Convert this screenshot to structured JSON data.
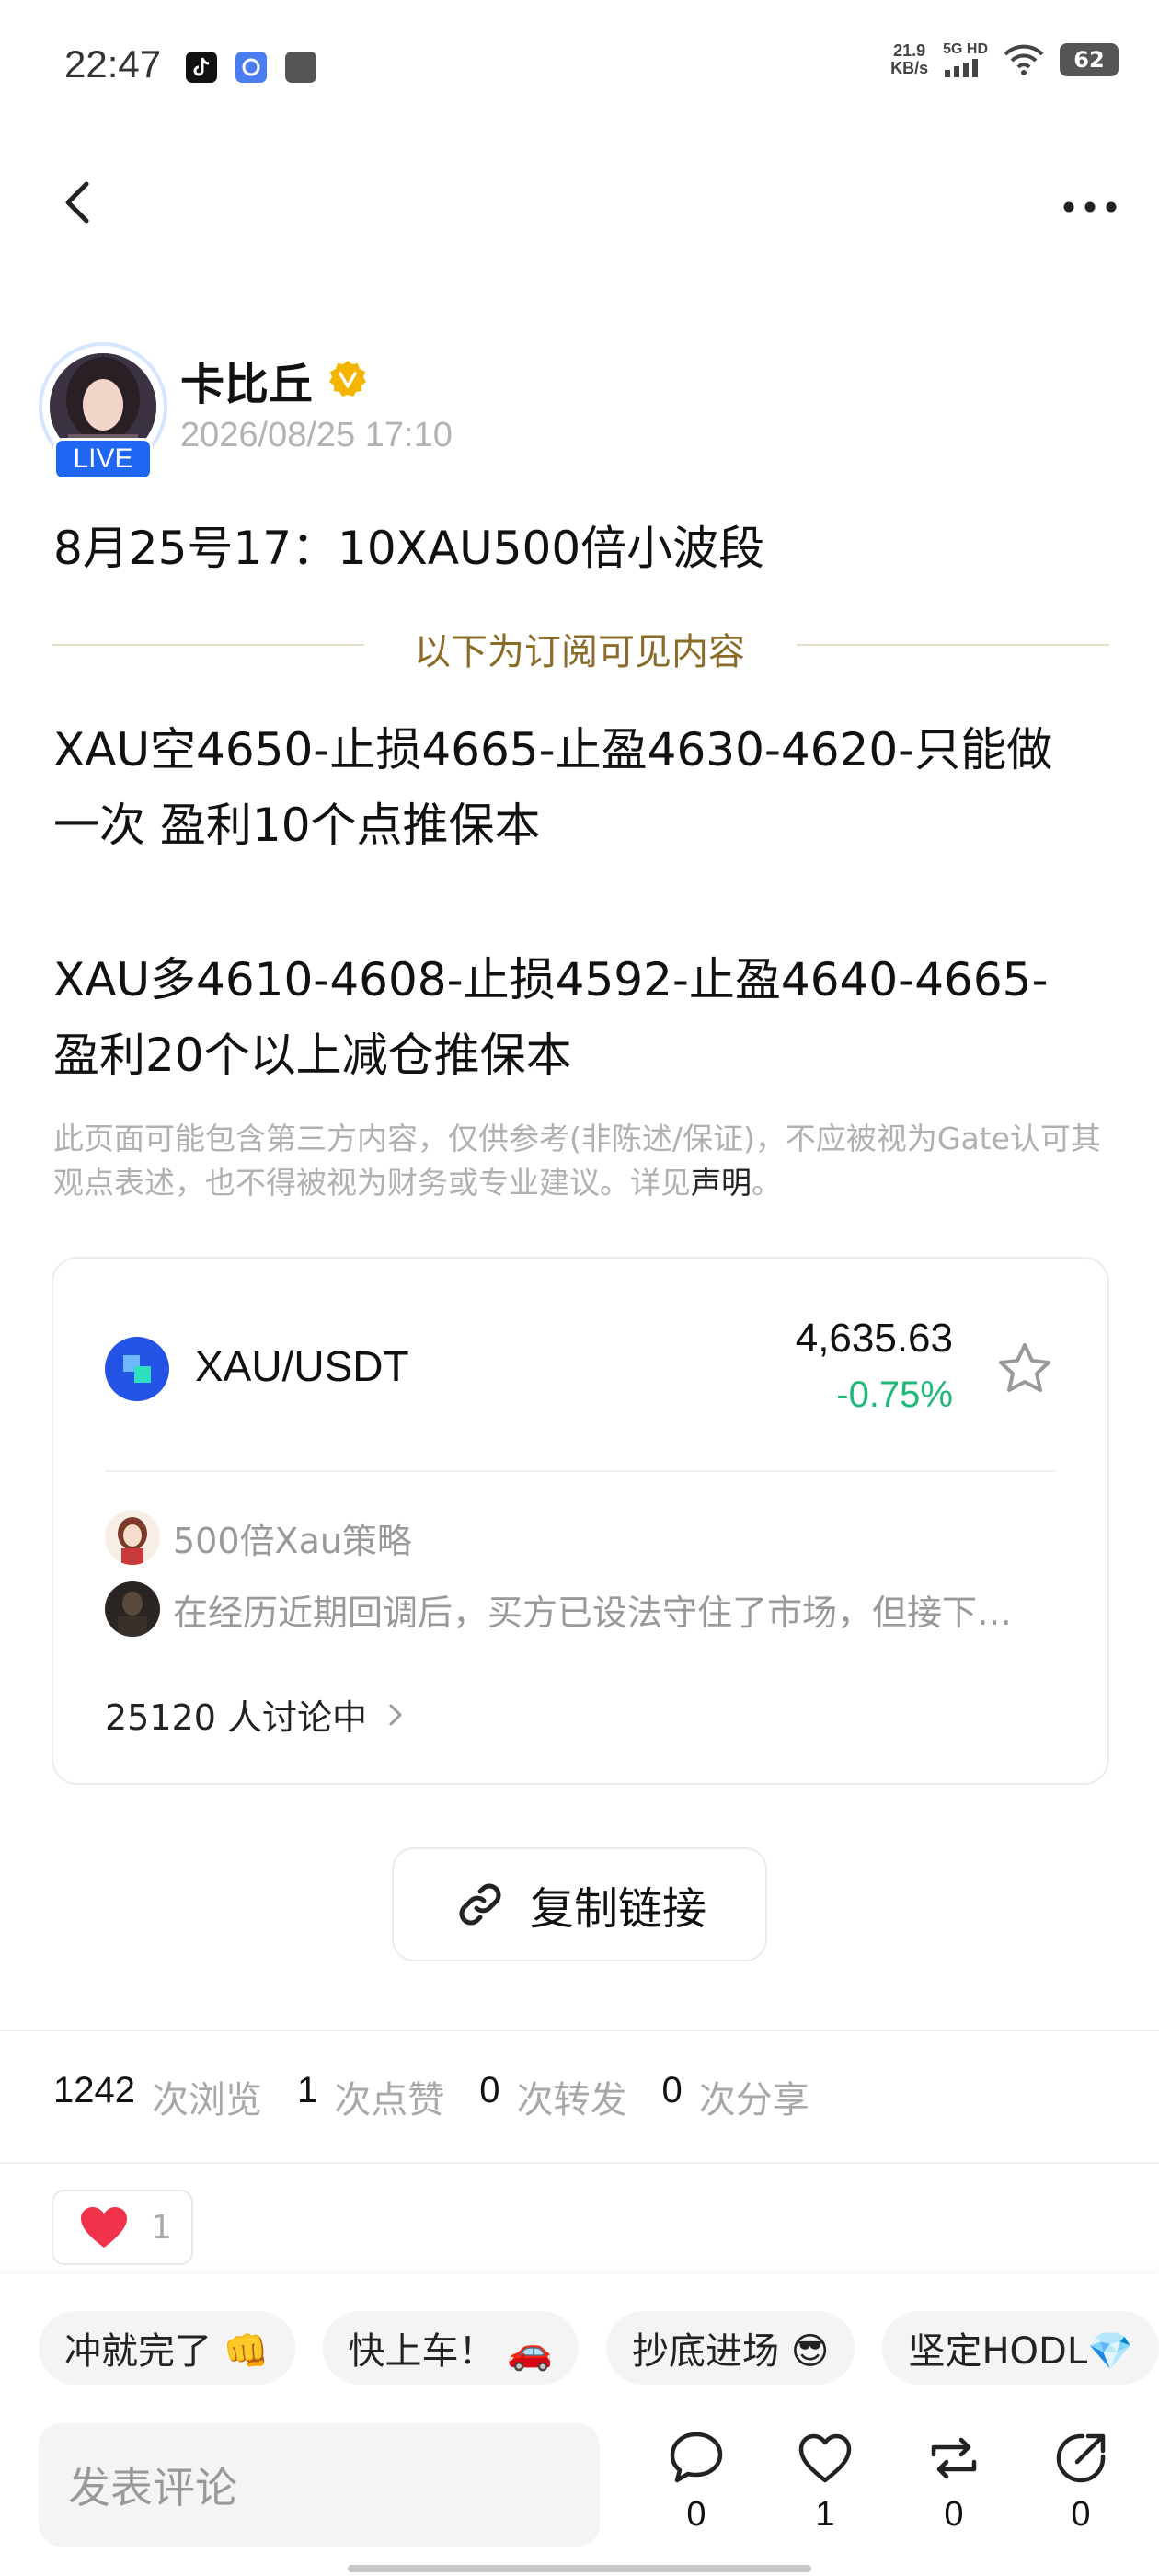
{
  "status_bar": {
    "time": "22:47",
    "speed_value": "21.9",
    "speed_unit": "KB/s",
    "network": "5G HD",
    "battery": "62"
  },
  "author": {
    "name": "卡比丘",
    "badge": "LIVE",
    "time": "2026/08/25 17:10"
  },
  "post": {
    "title": "8月25号17：10XAU500倍小波段",
    "subscriber_divider": "以下为订阅可见内容",
    "body1_line1": "XAU空4650-止损4665-止盈4630-4620-只能做",
    "body1_line2": "一次 盈利10个点推保本",
    "body2_line1": "XAU多4610-4608-止损4592-止盈4640-4665-",
    "body2_line2": "盈利20个以上减仓推保本",
    "disclaimer": "此页面可能包含第三方内容，仅供参考(非陈述/保证)，不应被视为Gate认可其观点表述，也不得被视为财务或专业建议。详见",
    "disclaimer_link": "声明",
    "disclaimer_end": "。"
  },
  "market": {
    "pair": "XAU/USDT",
    "price": "4,635.63",
    "change": "-0.75%",
    "discussions": [
      {
        "text": "500倍Xau策略"
      },
      {
        "text": "在经历近期回调后，买方已设法守住了市场，但接下…"
      }
    ],
    "discussing": "25120 人讨论中"
  },
  "copy_link": "复制链接",
  "stats": [
    {
      "num": "1242",
      "label": "次浏览"
    },
    {
      "num": "1",
      "label": "次点赞"
    },
    {
      "num": "0",
      "label": "次转发"
    },
    {
      "num": "0",
      "label": "次分享"
    }
  ],
  "reaction": {
    "count": "1"
  },
  "quick_replies": [
    "冲就完了 👊",
    "快上车！ 🚗",
    "抄底进场 😎",
    "坚定HODL💎"
  ],
  "comment_placeholder": "发表评论",
  "actions": {
    "comment": "0",
    "like": "1",
    "repost": "0",
    "share": "0"
  },
  "colors": {
    "accent": "#1f66f2",
    "positive": "#1fb97a",
    "gold": "#8a6b28",
    "like": "#f0334a"
  }
}
